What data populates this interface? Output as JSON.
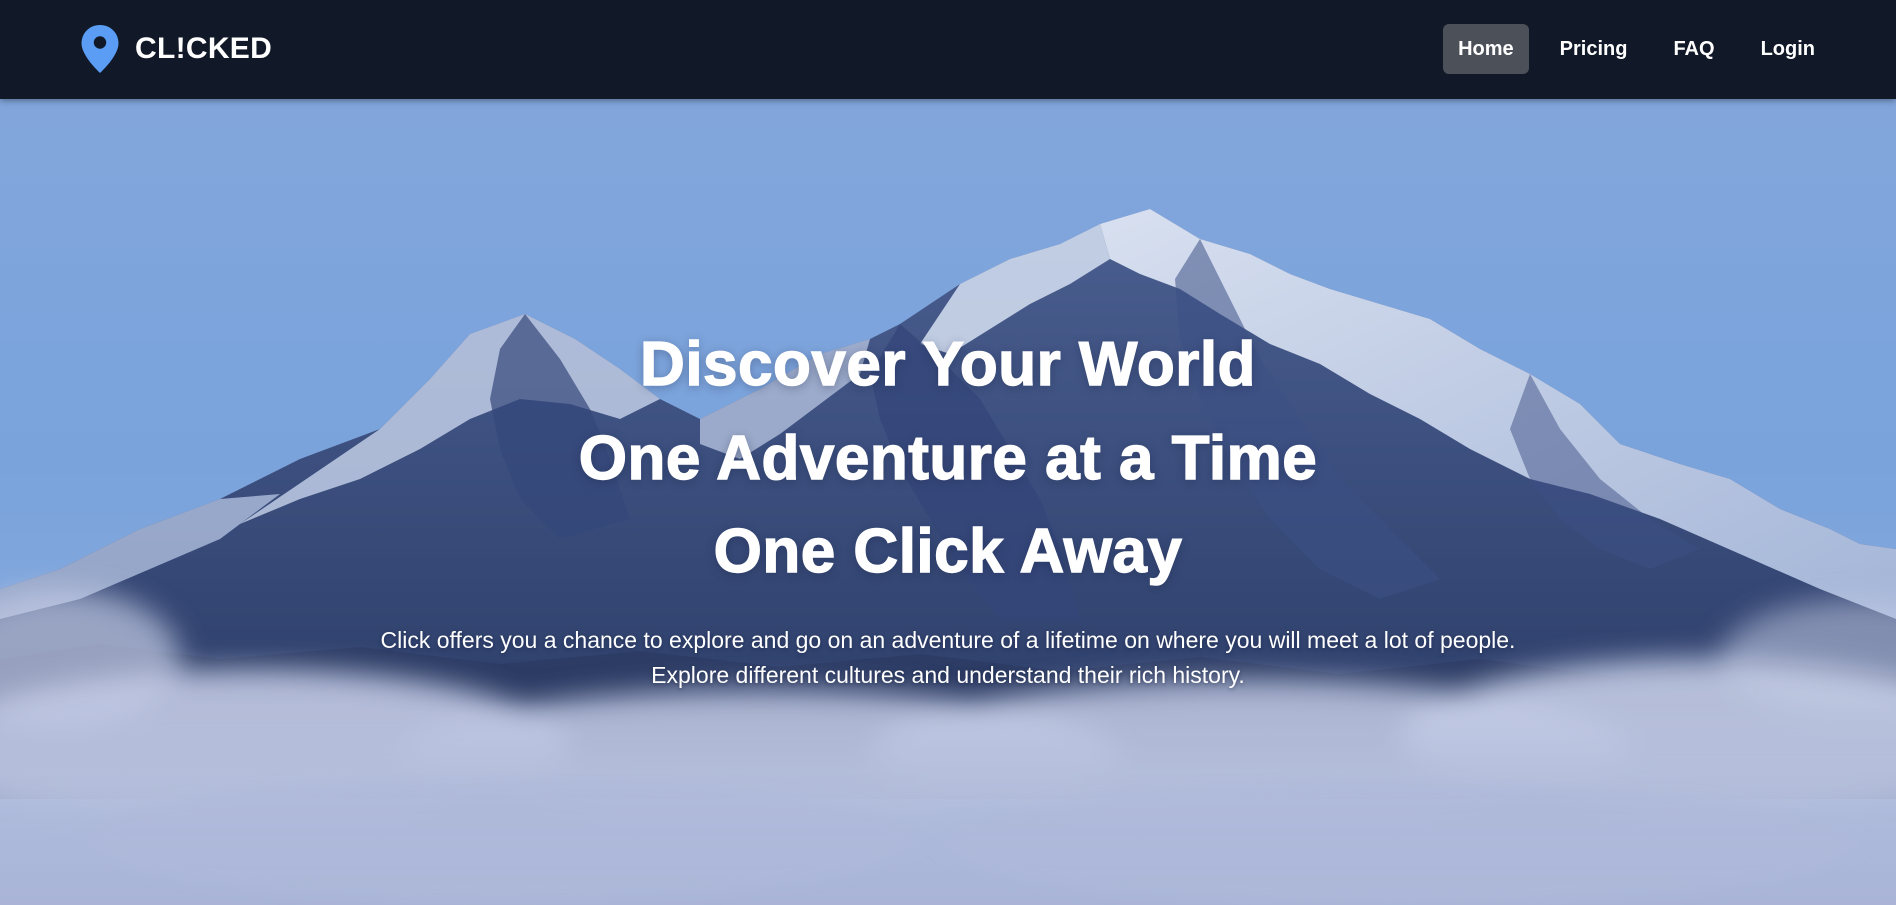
{
  "brand": {
    "name": "CL!CKED",
    "icon": "map-pin-icon",
    "icon_color": "#5b9cf5"
  },
  "nav": {
    "items": [
      {
        "label": "Home",
        "active": true
      },
      {
        "label": "Pricing",
        "active": false
      },
      {
        "label": "FAQ",
        "active": false
      },
      {
        "label": "Login",
        "active": false
      }
    ],
    "active_bg": "#4b5059",
    "bar_color": "#111827"
  },
  "hero": {
    "headline_lines": [
      "Discover Your World",
      "One Adventure at a Time",
      "One Click Away"
    ],
    "subtitle": "Click offers you a chance to explore and go on an adventure of a lifetime on where you will meet a lot of people. Explore different cultures and understand their rich history.",
    "background": "snowy-mountain-with-clouds"
  }
}
